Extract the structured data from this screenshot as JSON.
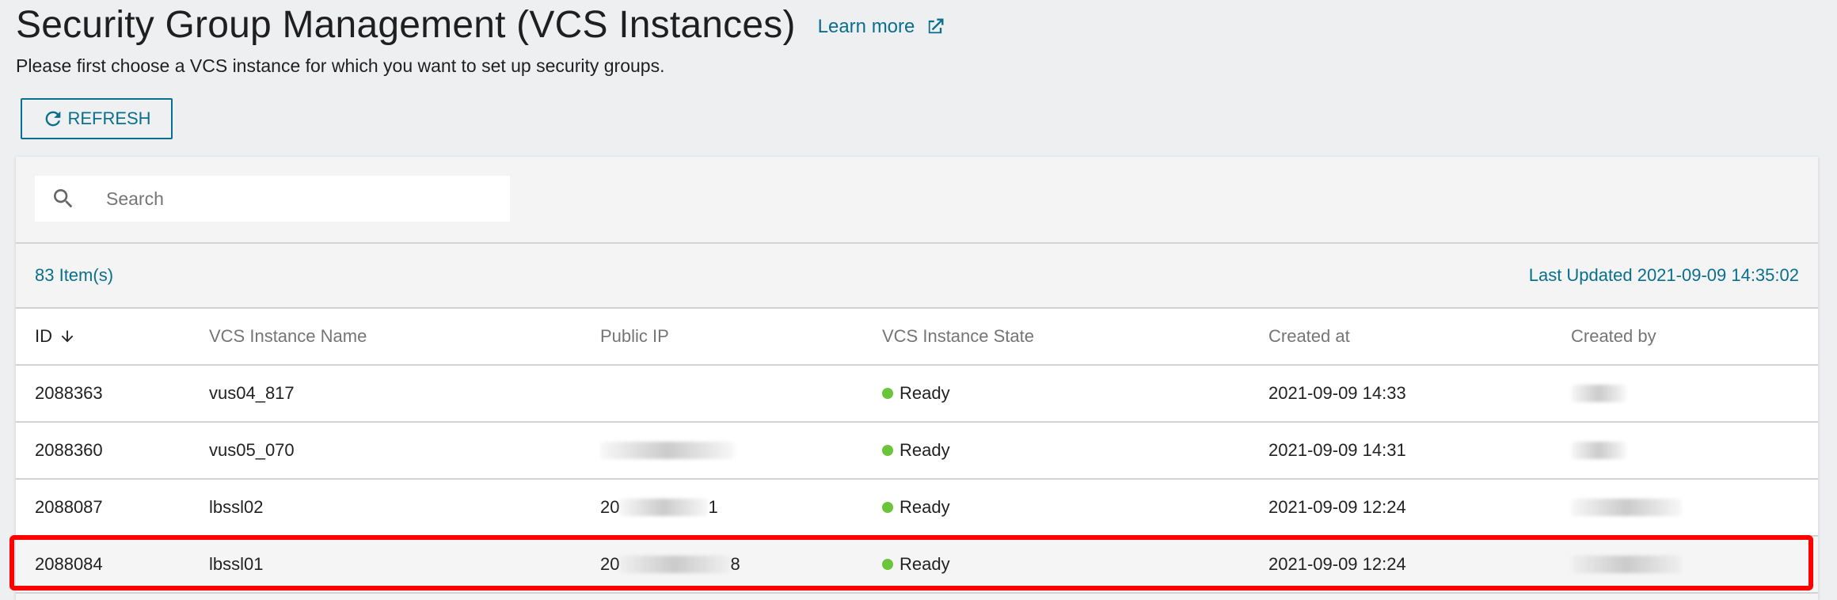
{
  "page": {
    "title": "Security Group Management (VCS Instances)",
    "learn_more": "Learn more",
    "subtitle": "Please first choose a VCS instance for which you want to set up security groups.",
    "refresh_label": "REFRESH"
  },
  "search": {
    "placeholder": "Search"
  },
  "summary": {
    "item_count": "83 Item(s)",
    "last_updated": "Last Updated 2021-09-09 14:35:02"
  },
  "table": {
    "columns": [
      "ID",
      "VCS Instance Name",
      "Public IP",
      "VCS Instance State",
      "Created at",
      "Created by"
    ],
    "rows": [
      {
        "id": "2088363",
        "name": "vus04_817",
        "ip_prefix": "",
        "ip_suffix": "",
        "state": "Ready",
        "created_at": "2021-09-09 14:33"
      },
      {
        "id": "2088360",
        "name": "vus05_070",
        "ip_prefix": "",
        "ip_suffix": "",
        "state": "Ready",
        "created_at": "2021-09-09 14:31"
      },
      {
        "id": "2088087",
        "name": "lbssl02",
        "ip_prefix": "20",
        "ip_suffix": "1",
        "state": "Ready",
        "created_at": "2021-09-09 12:24"
      },
      {
        "id": "2088084",
        "name": "lbssl01",
        "ip_prefix": "20",
        "ip_suffix": "8",
        "state": "Ready",
        "created_at": "2021-09-09 12:24"
      }
    ]
  },
  "colors": {
    "accent": "#0a6f8f",
    "status_ready": "#6cc43a",
    "highlight": "#ff0000"
  },
  "icons": {
    "learn_more": "external-link-icon",
    "refresh": "refresh-icon",
    "search": "search-icon",
    "sort": "arrow-down-icon",
    "status": "status-dot-icon"
  }
}
